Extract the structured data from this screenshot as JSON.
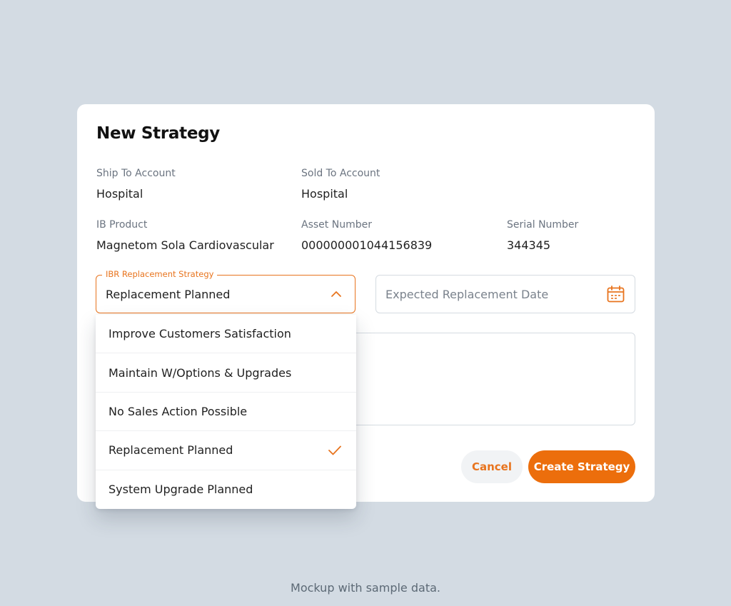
{
  "modal": {
    "title": "New Strategy",
    "fields": {
      "ship_to": {
        "label": "Ship To Account",
        "value": "Hospital"
      },
      "sold_to": {
        "label": "Sold To Account",
        "value": "Hospital"
      },
      "ib_product": {
        "label": "IB Product",
        "value": "Magnetom Sola Cardiovascular"
      },
      "asset_number": {
        "label": "Asset Number",
        "value": "000000001044156839"
      },
      "serial_number": {
        "label": "Serial Number",
        "value": "344345"
      }
    },
    "strategy_select": {
      "label": "IBR Replacement Strategy",
      "value": "Replacement Planned",
      "icon": "chevron-up-icon",
      "options": [
        {
          "label": "Improve Customers Satisfaction",
          "selected": false
        },
        {
          "label": "Maintain W/Options & Upgrades",
          "selected": false
        },
        {
          "label": "No Sales Action Possible",
          "selected": false
        },
        {
          "label": "Replacement Planned",
          "selected": true
        },
        {
          "label": "System Upgrade Planned",
          "selected": false
        }
      ]
    },
    "date_input": {
      "placeholder": "Expected Replacement Date",
      "icon": "calendar-icon"
    },
    "buttons": {
      "cancel_label": "Cancel",
      "create_label": "Create Strategy"
    }
  },
  "caption": "Mockup with sample data.",
  "colors": {
    "accent": "#ec6e0c",
    "background": "#d3dbe3",
    "surface": "#ffffff"
  }
}
